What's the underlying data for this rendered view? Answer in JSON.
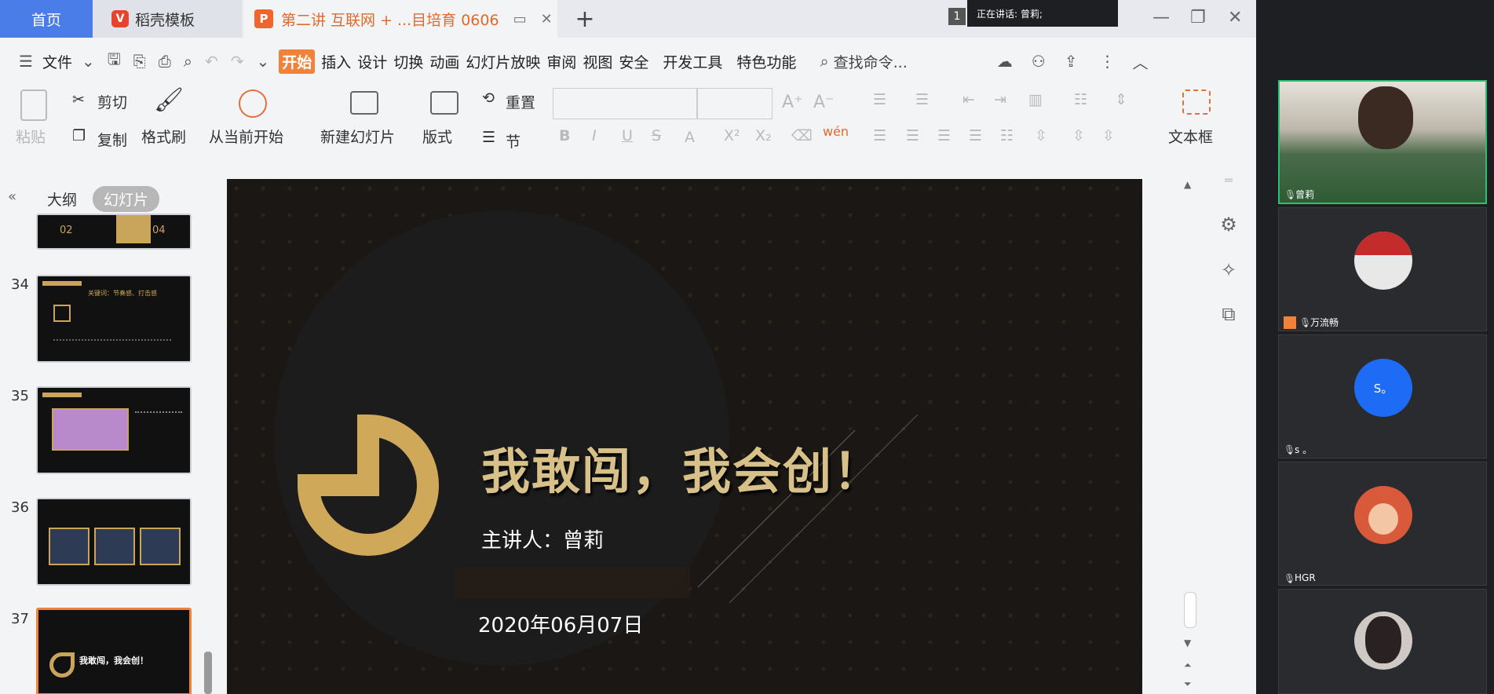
{
  "tabs": {
    "home": "首页",
    "daoke_logo": "V",
    "daoke": "稻壳模板",
    "doc_logo": "P",
    "doc": "第二讲 互联网 + ...目培育 0606",
    "add": "+"
  },
  "speaking": {
    "count": "1",
    "label": "正在讲话: 曾莉;"
  },
  "menu": {
    "file": "文件",
    "items": [
      "开始",
      "插入",
      "设计",
      "切换",
      "动画",
      "幻灯片放映",
      "审阅",
      "视图",
      "安全",
      "开发工具",
      "特色功能"
    ],
    "search_placeholder": "查找命令..."
  },
  "ribbon": {
    "paste": "粘贴",
    "cut": "剪切",
    "copy": "复制",
    "format_painter": "格式刷",
    "from_current": "从当前开始",
    "new_slide": "新建幻灯片",
    "layout": "版式",
    "reset": "重置",
    "section": "节",
    "textbox": "文本框"
  },
  "sidepane": {
    "outline": "大纲",
    "slides": "幻灯片",
    "thumbs": [
      {
        "num": "",
        "text_a": "02",
        "text_b": "04"
      },
      {
        "num": "34",
        "text_a": "关键词：节奏感、打击感"
      },
      {
        "num": "35",
        "text_a": ""
      },
      {
        "num": "36",
        "text_a": ""
      },
      {
        "num": "37",
        "text_a": "我敢闯，我会创！"
      }
    ]
  },
  "slide": {
    "title": "我敢闯，我会创！",
    "presenter": "主讲人：曾莉",
    "date": "2020年06月07日"
  },
  "meeting": {
    "participants": [
      {
        "name": "曾莉"
      },
      {
        "name": "万流畅"
      },
      {
        "name": "s 。",
        "avatar_text": "S。"
      },
      {
        "name": "HGR"
      },
      {
        "name": ""
      }
    ]
  },
  "colors": {
    "accent_orange": "#f0823a",
    "home_blue": "#4b7de9",
    "slide_gold": "#d8c089",
    "active_green": "#2fbf71"
  }
}
